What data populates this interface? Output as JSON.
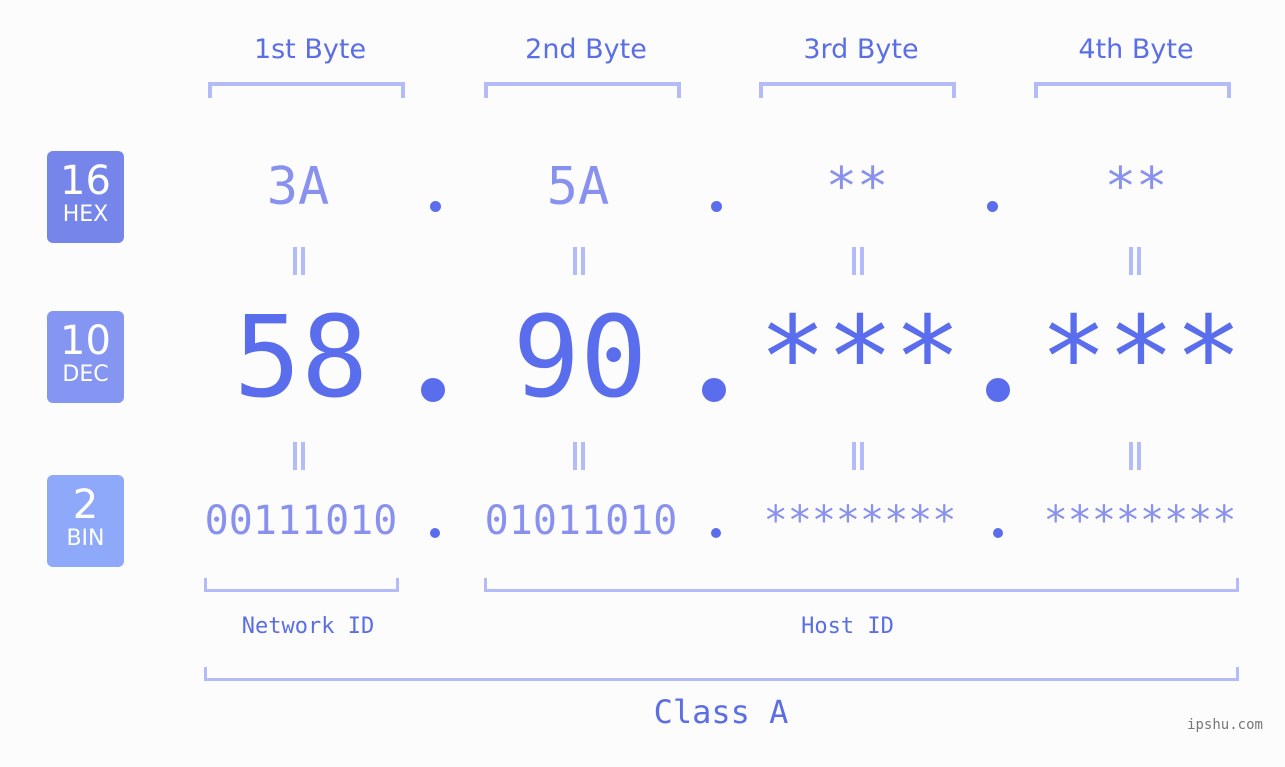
{
  "colors": {
    "accent": "#5a6ded",
    "light_value": "#8892ee",
    "bracket": "#b3bbf8",
    "badge_hex": "#7685ea",
    "badge_dec": "#8495f2",
    "badge_bin": "#8ea8fa",
    "background": "#fbfcfb"
  },
  "byte_headers": [
    "1st Byte",
    "2nd Byte",
    "3rd Byte",
    "4th Byte"
  ],
  "badges": {
    "hex": {
      "number": "16",
      "label": "HEX"
    },
    "dec": {
      "number": "10",
      "label": "DEC"
    },
    "bin": {
      "number": "2",
      "label": "BIN"
    }
  },
  "hex_values": [
    "3A",
    "5A",
    "**",
    "**"
  ],
  "dec_values": [
    "58",
    "90",
    "***",
    "***"
  ],
  "bin_values": [
    "00111010",
    "01011010",
    "********",
    "********"
  ],
  "labels": {
    "network_id": "Network ID",
    "host_id": "Host ID",
    "class": "Class A"
  },
  "watermark": "ipshu.com"
}
